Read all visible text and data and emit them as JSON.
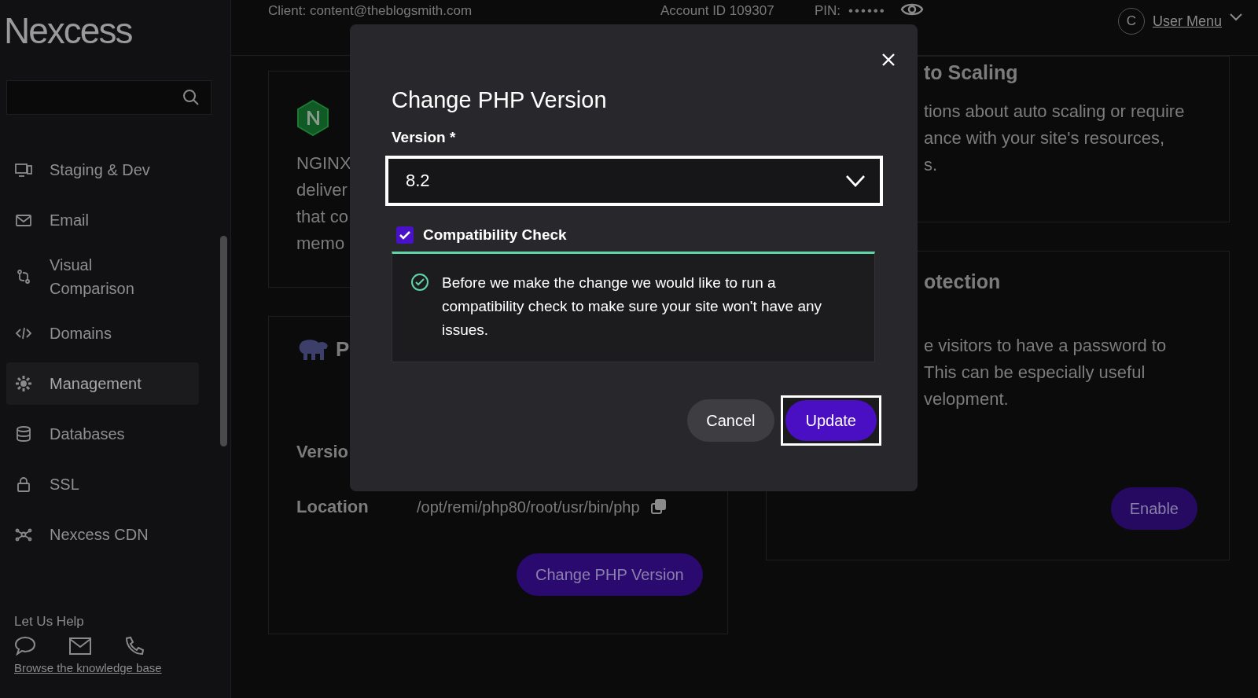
{
  "sidebar": {
    "logo": "Nexcess",
    "nav": [
      {
        "label": "Staging & Dev",
        "selected": false
      },
      {
        "label": "Email",
        "selected": false
      },
      {
        "label": "Visual Comparison",
        "selected": false
      },
      {
        "label": "Domains",
        "selected": false
      },
      {
        "label": "Management",
        "selected": true
      },
      {
        "label": "Databases",
        "selected": false
      },
      {
        "label": "SSL",
        "selected": false
      },
      {
        "label": "Nexcess CDN",
        "selected": false
      }
    ],
    "help": {
      "title": "Let Us Help",
      "link": "Browse the knowledge base"
    }
  },
  "header": {
    "client": "Client: content@theblogsmith.com",
    "account": "Account ID 109307",
    "pin_label": "PIN:",
    "pin_value": "••••••",
    "avatar": "C",
    "user_menu": "User Menu"
  },
  "left_cards": {
    "nginx_lines": [
      "NGINX",
      "deliver",
      "that co",
      "memo"
    ],
    "php_title": "P",
    "version_label": "Versio",
    "location_label": "Location",
    "location_value": "/opt/remi/php80/root/usr/bin/php",
    "change_button": "Change PHP Version"
  },
  "right_cards": [
    {
      "title": "to Scaling",
      "lines": [
        "tions about auto scaling or require",
        "ance with your site's resources,",
        "s."
      ]
    },
    {
      "title": "otection",
      "lines": [
        "e visitors to have a password to",
        "This can be especially useful",
        "velopment."
      ],
      "button": "Enable"
    }
  ],
  "dialog": {
    "title": "Change PHP Version",
    "field_label": "Version *",
    "value": "8.2",
    "checkbox": {
      "label": "Compatibility Check",
      "checked": true
    },
    "notice": "Before we make the change we would like to run a compatibility check to make sure your site won't have any issues.",
    "buttons": [
      {
        "label": "Cancel",
        "kind": "secondary"
      },
      {
        "label": "Update",
        "kind": "primary"
      }
    ]
  }
}
